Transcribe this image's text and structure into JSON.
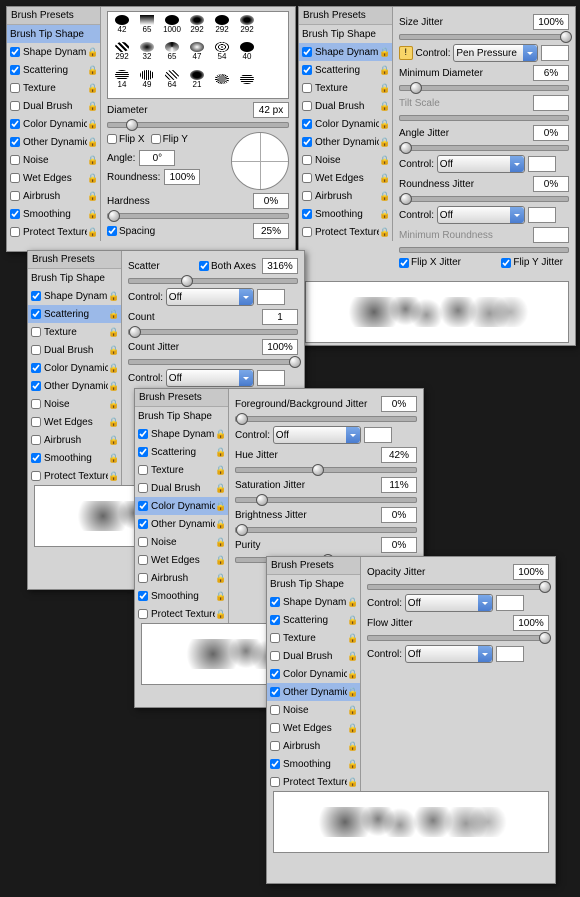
{
  "common": {
    "header": "Brush Presets",
    "tip": "Brush Tip Shape",
    "items": [
      "Shape Dynamics",
      "Scattering",
      "Texture",
      "Dual Brush",
      "Color Dynamics",
      "Other Dynamics",
      "Noise",
      "Wet Edges",
      "Airbrush",
      "Smoothing",
      "Protect Texture"
    ]
  },
  "p1": {
    "diameter_label": "Diameter",
    "diameter": "42 px",
    "flipx": "Flip X",
    "flipy": "Flip Y",
    "angle_label": "Angle:",
    "angle": "0°",
    "roundness_label": "Roundness:",
    "roundness": "100%",
    "hardness_label": "Hardness",
    "hardness": "0%",
    "spacing_label": "Spacing",
    "spacing": "25%",
    "swatches": [
      "42",
      "65",
      "1000",
      "292",
      "292",
      "292",
      "292",
      "32",
      "65",
      "47",
      "54",
      "40",
      "14",
      "49",
      "64",
      "21",
      "",
      "",
      "",
      "",
      "",
      "",
      "",
      ""
    ]
  },
  "p2": {
    "scatter_label": "Scatter",
    "both_axes": "Both Axes",
    "scatter": "316%",
    "control": "Control:",
    "off": "Off",
    "count_label": "Count",
    "count": "1",
    "cjitter_label": "Count Jitter",
    "cjitter": "100%"
  },
  "p3": {
    "size_label": "Size Jitter",
    "size": "100%",
    "ctrl": "Control:",
    "pen": "Pen Pressure",
    "min_label": "Minimum Diameter",
    "min": "6%",
    "tilt": "Tilt Scale",
    "angle_label": "Angle Jitter",
    "angle": "0%",
    "off": "Off",
    "round_label": "Roundness Jitter",
    "round": "0%",
    "minr": "Minimum Roundness",
    "fx": "Flip X Jitter",
    "fy": "Flip Y Jitter"
  },
  "p4": {
    "fgbg_label": "Foreground/Background Jitter",
    "fgbg": "0%",
    "ctrl": "Control:",
    "off": "Off",
    "hue_label": "Hue Jitter",
    "hue": "42%",
    "sat_label": "Saturation Jitter",
    "sat": "11%",
    "bri_label": "Brightness Jitter",
    "bri": "0%",
    "pur_label": "Purity",
    "pur": "0%"
  },
  "p5": {
    "op_label": "Opacity Jitter",
    "op": "100%",
    "ctrl": "Control:",
    "off": "Off",
    "flow_label": "Flow Jitter",
    "flow": "100%"
  }
}
